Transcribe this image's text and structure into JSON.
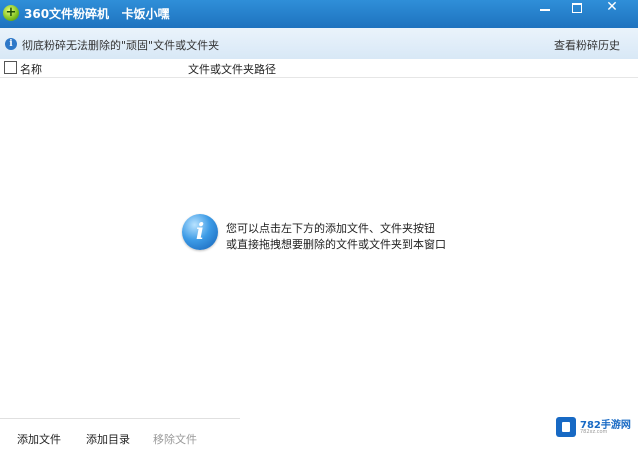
{
  "window": {
    "title": "360文件粉碎机",
    "subtitle": "卡饭小嘿",
    "controls": {
      "minimize_icon": "minimize-icon",
      "maximize_icon": "maximize-icon",
      "close_icon": "close-icon",
      "close_glyph": "✕"
    }
  },
  "info_bar": {
    "icon": "i",
    "text": "彻底粉碎无法删除的\"顽固\"文件或文件夹",
    "history_link": "查看粉碎历史"
  },
  "table": {
    "columns": [
      "名称",
      "文件或文件夹路径"
    ]
  },
  "empty_state": {
    "icon": "i",
    "line1": "您可以点击左下方的添加文件、文件夹按钮",
    "line2": "或直接拖拽想要删除的文件或文件夹到本窗口"
  },
  "footer": {
    "add_file": "添加文件",
    "add_folder": "添加目录",
    "remove_file": "移除文件"
  },
  "watermark": {
    "text": "782手游网",
    "sub": "782xz.com"
  },
  "colors": {
    "titlebar": "#1e72bf",
    "accent": "#2e78c8",
    "disabled_text": "#9a9a9a"
  }
}
